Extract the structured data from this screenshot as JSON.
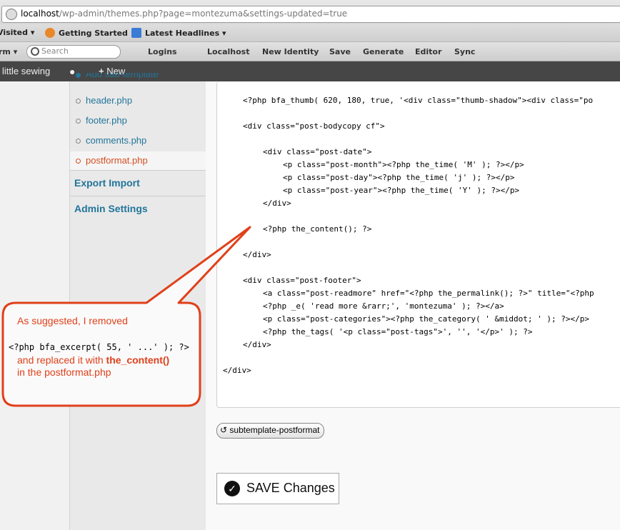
{
  "browser": {
    "url_host": "localhost",
    "url_rest": "/wp-admin/themes.php?page=montezuma&settings-updated=true",
    "bookmarks": [
      "Visited ▾",
      "Getting Started",
      "Latest Headlines ▾"
    ],
    "toolbar": {
      "form_label": "rm ▾",
      "search_placeholder": "Search",
      "items": [
        "Logins",
        "Localhost",
        "New Identity",
        "Save",
        "Generate",
        "Editor",
        "Sync"
      ]
    }
  },
  "adminbar": {
    "site": "little sewing",
    "new_label": "New"
  },
  "sidebar": {
    "cut_item": "Add sub-template",
    "items": [
      {
        "label": "header.php"
      },
      {
        "label": "footer.php"
      },
      {
        "label": "comments.php"
      },
      {
        "label": "postformat.php",
        "active": true
      }
    ],
    "sections": [
      "Export Import",
      "Admin Settings"
    ]
  },
  "code_lines": [
    "<?php bfa_thumb( 620, 180, true, '<div class=\"thumb-shadow\"><div class=\"po",
    "<div class=\"post-bodycopy cf\">",
    "<div class=\"post-date\">",
    "<p class=\"post-month\"><?php the_time( 'M' ); ?></p>",
    "<p class=\"post-day\"><?php the_time( 'j' ); ?></p>",
    "<p class=\"post-year\"><?php the_time( 'Y' ); ?></p>",
    "</div>",
    "<?php the_content(); ?>",
    "</div>",
    "<div class=\"post-footer\">",
    "<a class=\"post-readmore\" href=\"<?php the_permalink(); ?>\" title=\"<?php",
    "<?php _e( 'read more &rarr;', 'montezuma' ); ?></a>",
    "<p class=\"post-categories\"><?php the_category( ' &middot; ' ); ?></p>",
    "<?php the_tags( '<p class=\"post-tags\">', '', '</p>' ); ?>",
    "</div>",
    "</div>"
  ],
  "subtemplate_button": "subtemplate-postformat",
  "save_button": "SAVE Changes",
  "callout": {
    "line1": "As suggested, I removed",
    "code": "<?php bfa_excerpt( 55, ' ...' ); ?>",
    "line3a": "and replaced it with ",
    "line3b": "the_content()",
    "line4": "in the postformat.php"
  },
  "colors": {
    "callout_red": "#e0401a",
    "link": "#21759b",
    "active": "#d54e21"
  }
}
